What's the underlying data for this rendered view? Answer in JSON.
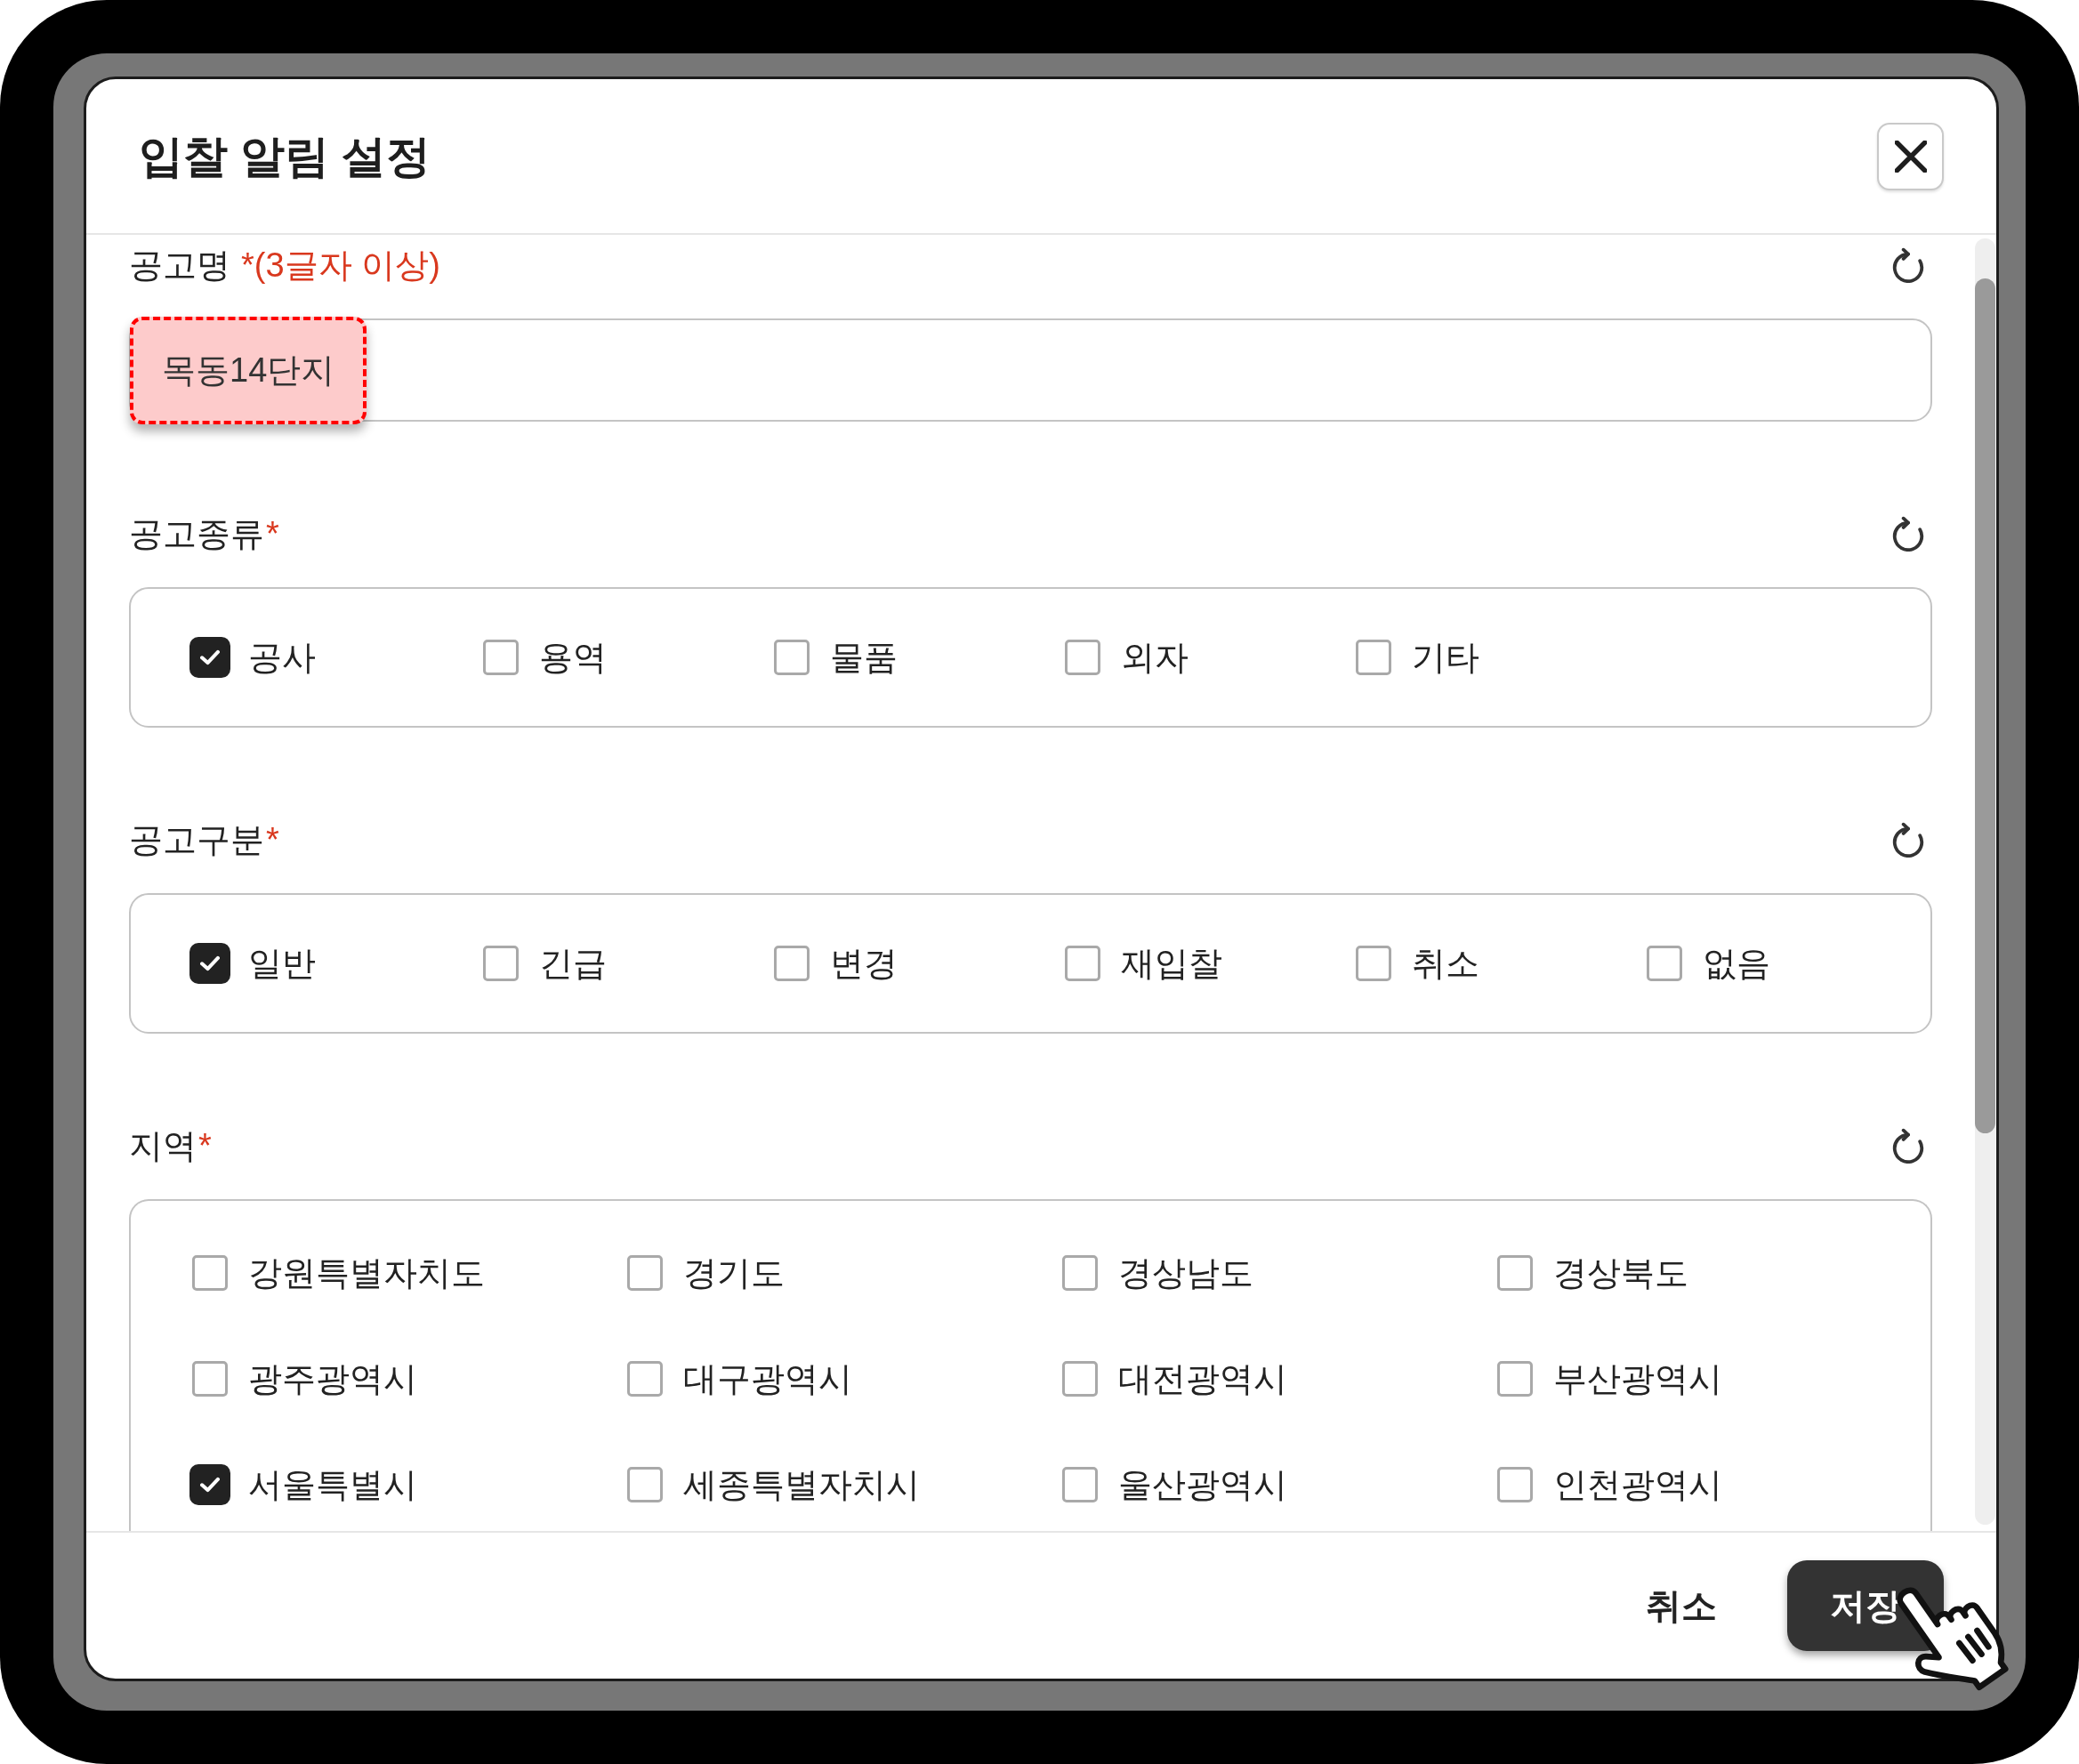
{
  "dialog": {
    "title": "입찰 알림 설정"
  },
  "sections": [
    {
      "kind": "text",
      "label": "공고명",
      "required_note": "*(3글자 이상)",
      "input": {
        "value": "목동14단지",
        "highlighted": true
      }
    },
    {
      "kind": "row",
      "label": "공고종류",
      "required_note": "*",
      "options": [
        {
          "label": "공사",
          "checked": true
        },
        {
          "label": "용역",
          "checked": false
        },
        {
          "label": "물품",
          "checked": false
        },
        {
          "label": "외자",
          "checked": false
        },
        {
          "label": "기타",
          "checked": false
        }
      ]
    },
    {
      "kind": "row",
      "label": "공고구분",
      "required_note": "*",
      "options": [
        {
          "label": "일반",
          "checked": true
        },
        {
          "label": "긴급",
          "checked": false
        },
        {
          "label": "변경",
          "checked": false
        },
        {
          "label": "재입찰",
          "checked": false
        },
        {
          "label": "취소",
          "checked": false
        },
        {
          "label": "없음",
          "checked": false
        }
      ]
    },
    {
      "kind": "grid",
      "label": "지역",
      "required_note": "*",
      "options": [
        {
          "label": "강원특별자치도",
          "checked": false
        },
        {
          "label": "경기도",
          "checked": false
        },
        {
          "label": "경상남도",
          "checked": false
        },
        {
          "label": "경상북도",
          "checked": false
        },
        {
          "label": "광주광역시",
          "checked": false
        },
        {
          "label": "대구광역시",
          "checked": false
        },
        {
          "label": "대전광역시",
          "checked": false
        },
        {
          "label": "부산광역시",
          "checked": false
        },
        {
          "label": "서울특별시",
          "checked": true
        },
        {
          "label": "세종특별자치시",
          "checked": false
        },
        {
          "label": "울산광역시",
          "checked": false
        },
        {
          "label": "인천광역시",
          "checked": false
        }
      ]
    }
  ],
  "footer": {
    "buttons": [
      {
        "label": "취소",
        "kind": "secondary"
      },
      {
        "label": "저장",
        "kind": "primary"
      }
    ]
  }
}
